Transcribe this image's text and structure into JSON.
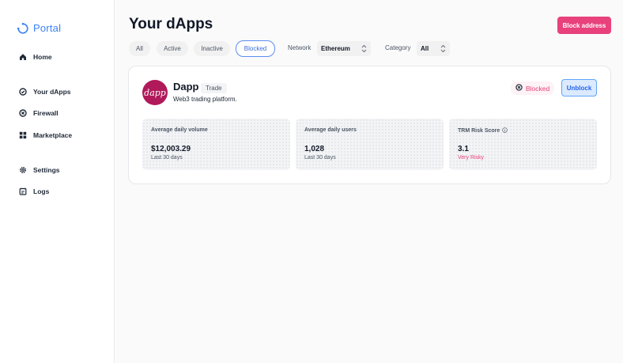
{
  "app": {
    "name": "Portal"
  },
  "sidebar": {
    "items": [
      {
        "label": "Home",
        "icon": "home-icon"
      },
      {
        "label": "Your dApps",
        "icon": "target-icon"
      },
      {
        "label": "Firewall",
        "icon": "shield-x-icon"
      },
      {
        "label": "Marketplace",
        "icon": "grid-icon"
      },
      {
        "label": "Settings",
        "icon": "gear-icon"
      },
      {
        "label": "Logs",
        "icon": "logs-icon"
      }
    ]
  },
  "header": {
    "title": "Your dApps",
    "block_label": "Block address"
  },
  "filters": {
    "tabs": [
      "All",
      "Active",
      "Inactive",
      "Blocked"
    ],
    "active_tab": "Blocked",
    "network_label": "Network",
    "network_value": "Ethereum",
    "category_label": "Category",
    "category_value": "All"
  },
  "dapp": {
    "logo_text": "dapp",
    "name": "Dapp",
    "tag": "Trade",
    "description": "Web3 trading platform.",
    "status": "Blocked",
    "unblock_label": "Unblock",
    "stats": [
      {
        "label": "Average daily volume",
        "value": "$12,003.29",
        "sub": "Last 30 days"
      },
      {
        "label": "Average daily users",
        "value": "1,028",
        "sub": "Last 30 days"
      },
      {
        "label": "TRM Risk Score",
        "value": "3.1",
        "sub": "Very Risky"
      }
    ]
  },
  "colors": {
    "accent": "#3b82f6",
    "danger": "#e8417c",
    "dapp_brand": "#b0195a"
  }
}
